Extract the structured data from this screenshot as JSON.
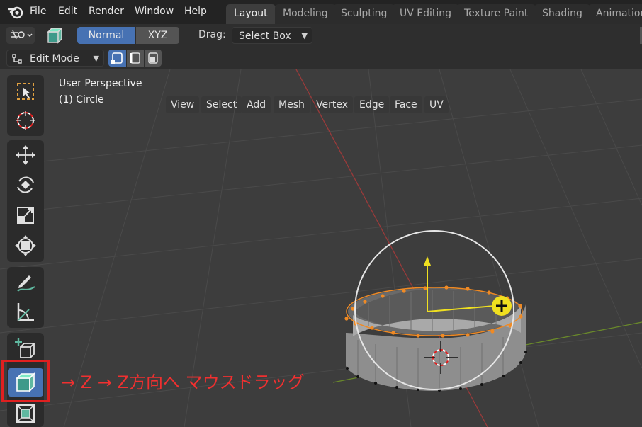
{
  "menu": {
    "items": [
      "File",
      "Edit",
      "Render",
      "Window",
      "Help"
    ]
  },
  "workspaces": {
    "tabs": [
      "Layout",
      "Modeling",
      "Sculpting",
      "UV Editing",
      "Texture Paint",
      "Shading",
      "Animation"
    ],
    "active": "Layout"
  },
  "header": {
    "orientation_normal": "Normal",
    "orientation_xyz": "XYZ",
    "drag_label": "Drag:",
    "drag_value": "Select Box",
    "mode_value": "Edit Mode",
    "view_menus": [
      "View",
      "Select",
      "Add",
      "Mesh",
      "Vertex",
      "Edge",
      "Face",
      "UV"
    ]
  },
  "viewport": {
    "perspective_label": "User Perspective",
    "object_label": "(1) Circle"
  },
  "annotation": {
    "text": "→ Z → Z方向へ マウスドラッグ"
  },
  "tools": [
    "select-box-icon",
    "cursor-icon",
    "move-icon",
    "rotate-icon",
    "scale-icon",
    "transform-icon",
    "annotate-icon",
    "measure-icon",
    "add-cube-icon",
    "extrude-region-icon",
    "inset-faces-icon"
  ],
  "colors": {
    "accent": "#4772b3",
    "annotation_red": "#e02020",
    "vertex_orange": "#f08a24",
    "gizmo_yellow": "#f0e020"
  }
}
